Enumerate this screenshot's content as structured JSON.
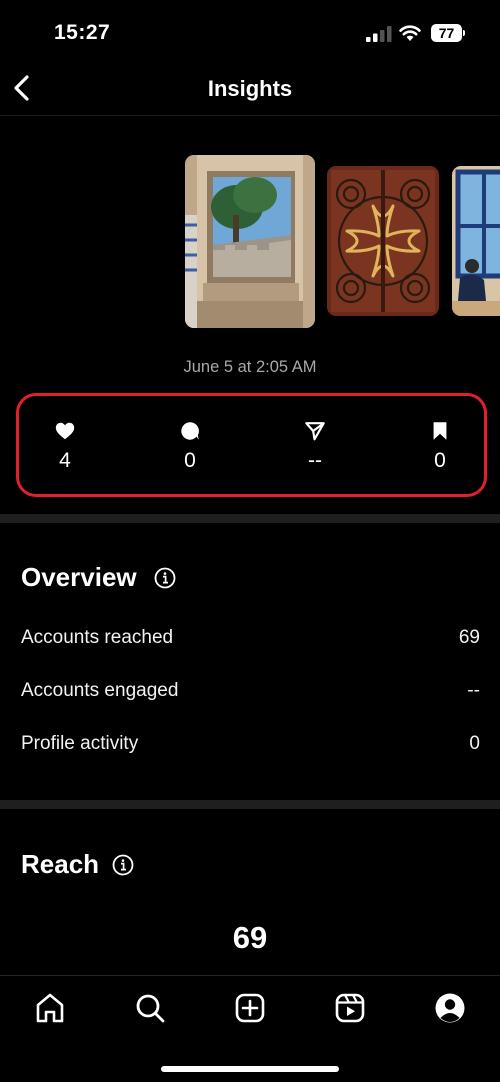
{
  "status_bar": {
    "time": "15:27",
    "battery": "77"
  },
  "nav": {
    "title": "Insights",
    "back_icon": "chevron-left-icon"
  },
  "post": {
    "date": "June 5 at 2:05 AM",
    "thumbnails": [
      "castle-window-photo",
      "ornate-gate-photo",
      "window-person-photo"
    ]
  },
  "stats": [
    {
      "icon": "heart-icon",
      "value": "4"
    },
    {
      "icon": "comment-icon",
      "value": "0"
    },
    {
      "icon": "send-icon",
      "value": "--"
    },
    {
      "icon": "bookmark-icon",
      "value": "0"
    }
  ],
  "overview": {
    "title": "Overview",
    "rows": [
      {
        "label": "Accounts reached",
        "value": "69"
      },
      {
        "label": "Accounts engaged",
        "value": "--"
      },
      {
        "label": "Profile activity",
        "value": "0"
      }
    ]
  },
  "reach": {
    "title": "Reach",
    "value": "69"
  },
  "tab_bar": {
    "tabs": [
      "home-icon",
      "search-icon",
      "create-icon",
      "reels-icon",
      "profile-icon"
    ]
  },
  "colors": {
    "background": "#000000",
    "highlight_border": "#e0202b",
    "muted_text": "#a8a8a8",
    "divider": "#1f1f1f"
  }
}
